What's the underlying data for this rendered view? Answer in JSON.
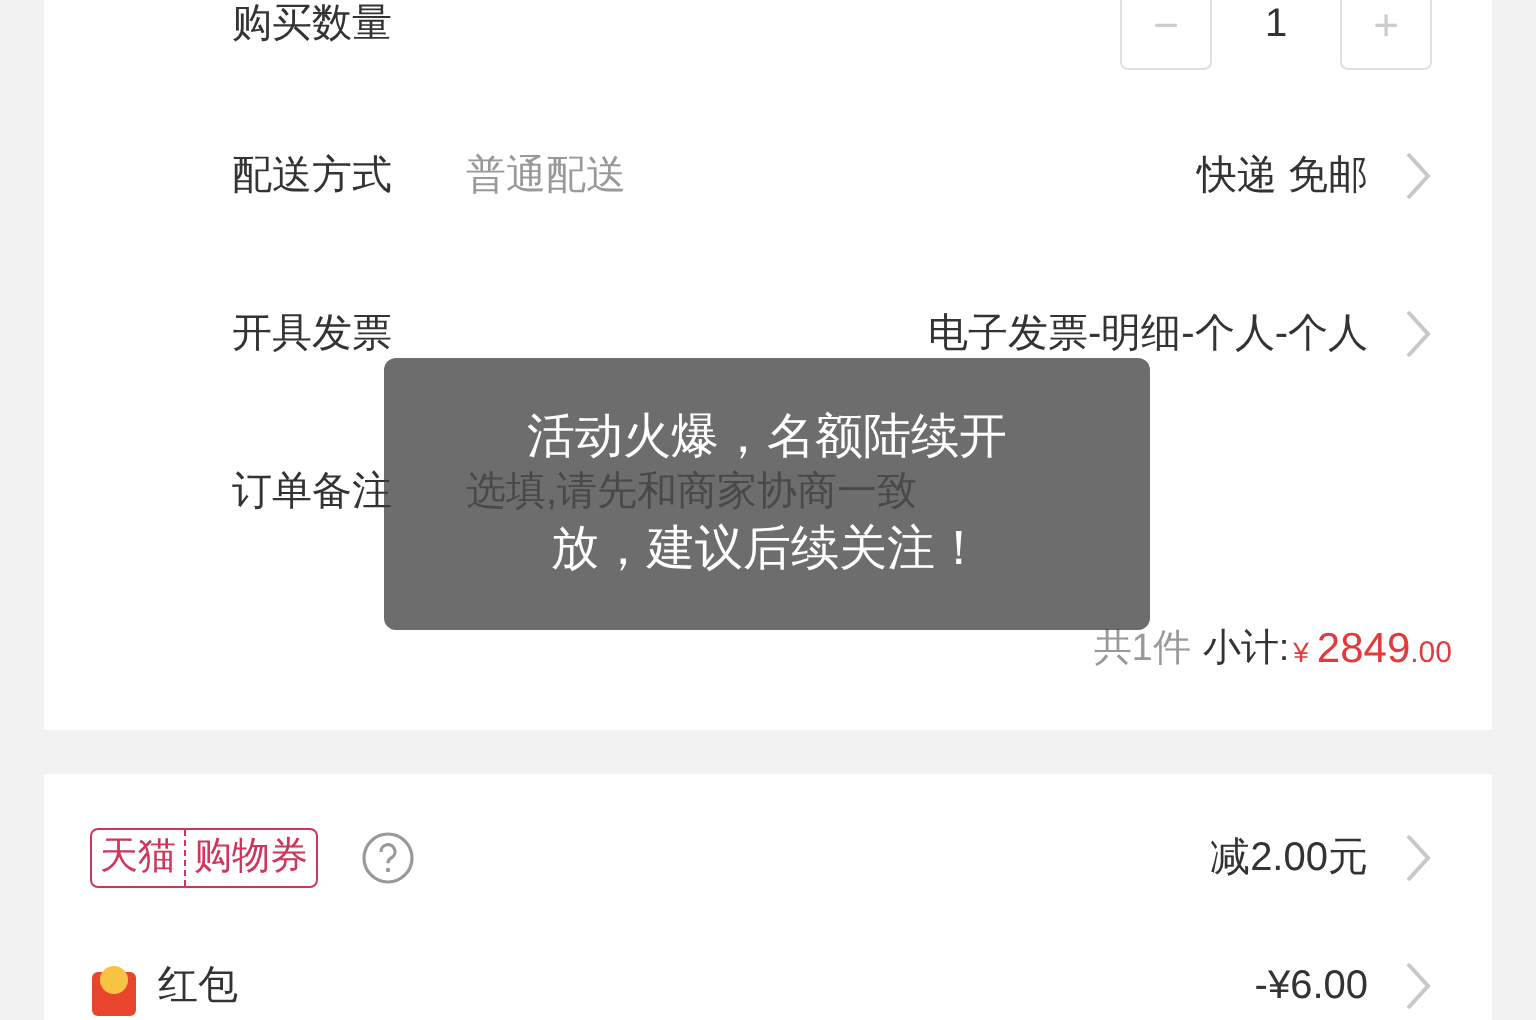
{
  "order_items": [
    {
      "kind": "stepper",
      "label": "购买数量",
      "minus": "−",
      "quantity": "1",
      "plus": "+"
    },
    {
      "kind": "option",
      "label": "配送方式",
      "detail": "普通配送",
      "value": "快递 免邮"
    },
    {
      "kind": "option",
      "label": "开具发票",
      "value": "电子发票-明细-个人-个人"
    },
    {
      "kind": "input",
      "label": "订单备注",
      "placeholder": "选填,请先和商家协商一致"
    }
  ],
  "summary": {
    "count": "共1件",
    "subtotal_label": "小计:",
    "currency": "¥",
    "amount": "2849",
    "cents": ".00"
  },
  "discounts": [
    {
      "kind": "coupon",
      "badge": [
        "天猫",
        "购物券"
      ],
      "value": "减2.00元"
    },
    {
      "kind": "red_packet",
      "label": "红包",
      "value": "-¥6.00"
    }
  ],
  "toast": "活动火爆，名额陆续开放，建议后续关注！"
}
